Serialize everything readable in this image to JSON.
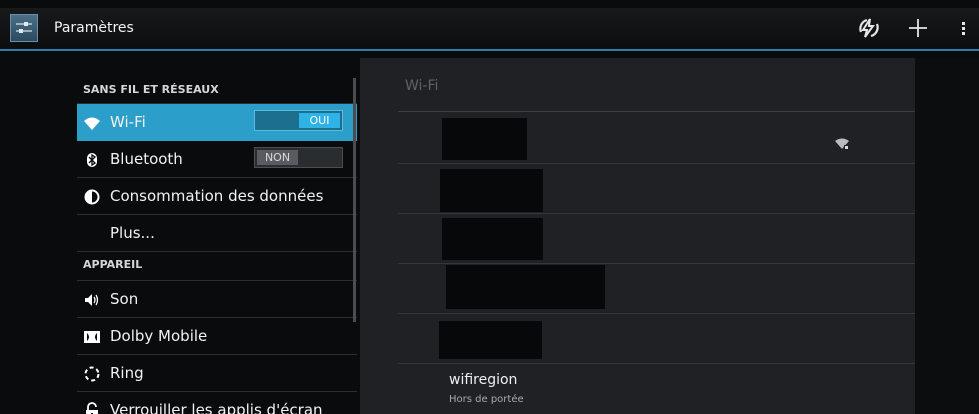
{
  "app": {
    "title": "Paramètres",
    "icon": "settings-sliders-icon"
  },
  "actionbar": {
    "actions": [
      "sync-icon",
      "add-icon",
      "overflow-menu-icon"
    ]
  },
  "nav": {
    "sections": [
      {
        "title": "SANS FIL ET RÉSEAUX"
      },
      {
        "title": "APPAREIL"
      }
    ],
    "items": [
      {
        "label": "Wi-Fi",
        "icon": "wifi-icon",
        "toggle": "OUI",
        "selected": true
      },
      {
        "label": "Bluetooth",
        "icon": "bluetooth-icon",
        "toggle": "NON"
      },
      {
        "label": "Consommation des données",
        "icon": "data-usage-icon"
      },
      {
        "label": "Plus...",
        "icon": ""
      },
      {
        "label": "Son",
        "icon": "speaker-icon"
      },
      {
        "label": "Dolby Mobile",
        "icon": "dolby-icon"
      },
      {
        "label": "Ring",
        "icon": "ring-icon"
      },
      {
        "label": "Verrouiller les applis d'écran",
        "icon": "lock-icon"
      }
    ]
  },
  "detail": {
    "title": "Wi-Fi",
    "network": {
      "name": "wifiregion",
      "status": "Hors de portée"
    }
  },
  "colors": {
    "accent": "#2b9fca",
    "actionbar_line": "#2c80a8",
    "pane_bg": "#1f2124"
  }
}
